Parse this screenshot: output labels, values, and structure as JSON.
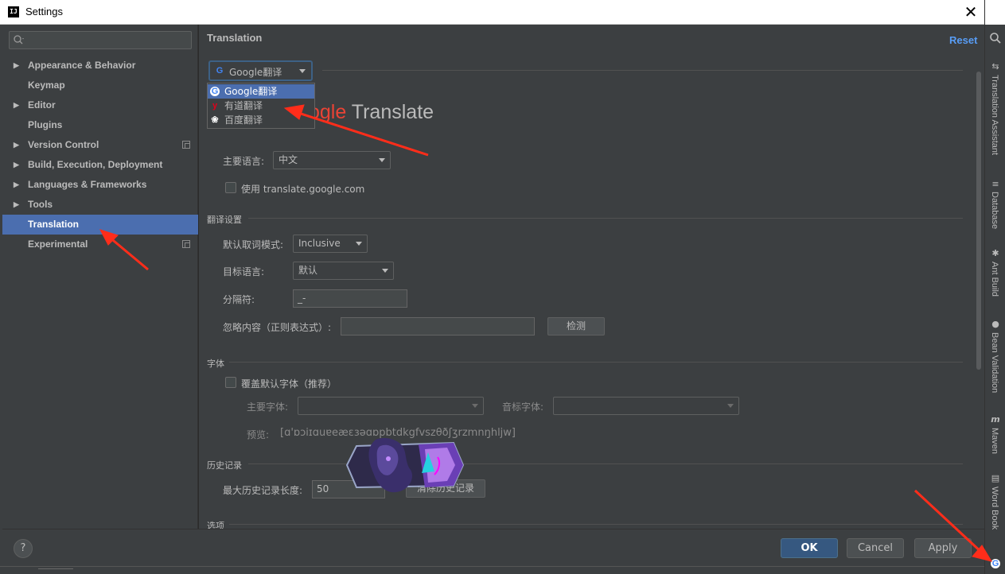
{
  "window": {
    "title": "Settings"
  },
  "nav": {
    "items": [
      {
        "label": "Appearance & Behavior",
        "arrow": "▶",
        "copy": false
      },
      {
        "label": "Keymap",
        "arrow": "",
        "copy": false
      },
      {
        "label": "Editor",
        "arrow": "▶",
        "copy": false
      },
      {
        "label": "Plugins",
        "arrow": "",
        "copy": false
      },
      {
        "label": "Version Control",
        "arrow": "▶",
        "copy": true
      },
      {
        "label": "Build, Execution, Deployment",
        "arrow": "▶",
        "copy": false
      },
      {
        "label": "Languages & Frameworks",
        "arrow": "▶",
        "copy": false
      },
      {
        "label": "Tools",
        "arrow": "▶",
        "copy": false
      },
      {
        "label": "Translation",
        "arrow": "",
        "copy": false,
        "selected": true
      },
      {
        "label": "Experimental",
        "arrow": "",
        "copy": true
      }
    ]
  },
  "content": {
    "title": "Translation",
    "reset": "Reset",
    "engine": {
      "selected": "Google翻译",
      "options": [
        {
          "label": "Google翻译",
          "icon": "google-icon"
        },
        {
          "label": "有道翻译",
          "icon": "youdao-icon"
        },
        {
          "label": "百度翻译",
          "icon": "baidu-icon"
        }
      ],
      "logo_tail": "ogle",
      "logo_word": "Translate"
    },
    "primary_lang": {
      "label": "主要语言:",
      "value": "中文"
    },
    "use_google_cn": {
      "label": "使用 translate.google.com",
      "checked": false
    },
    "translation_settings": {
      "section": "翻译设置",
      "word_mode": {
        "label": "默认取词模式:",
        "value": "Inclusive"
      },
      "target_lang": {
        "label": "目标语言:",
        "value": "默认"
      },
      "separator": {
        "label": "分隔符:",
        "value": "_-"
      },
      "ignore": {
        "label": "忽略内容（正则表达式）:",
        "value": "",
        "button": "检测"
      }
    },
    "font": {
      "section": "字体",
      "override": {
        "label": "覆盖默认字体（推荐）",
        "checked": false
      },
      "primary_font": {
        "label": "主要字体:",
        "value": ""
      },
      "phonetic_font": {
        "label": "音标字体:",
        "value": ""
      },
      "preview_label": "预览:",
      "preview_text": "[ɑ'ɒɔiɪɑuɐeæɛɜəɑɒpbtdkgfvszθðʃʒrzmnŋhljw]"
    },
    "history": {
      "section": "历史记录",
      "max_len": {
        "label": "最大历史记录长度:",
        "value": "50"
      },
      "clear_button": "清除历史记录"
    },
    "options": {
      "section": "选项"
    }
  },
  "buttons": {
    "help": "?",
    "ok": "OK",
    "cancel": "Cancel",
    "apply": "Apply"
  },
  "right_tools": [
    {
      "label": "Translation Assistant",
      "icon": "translate-icon"
    },
    {
      "label": "Database",
      "icon": "database-icon"
    },
    {
      "label": "Ant Build",
      "icon": "ant-icon"
    },
    {
      "label": "Bean Validation",
      "icon": "bean-icon"
    },
    {
      "label": "Maven",
      "icon": "maven-icon"
    },
    {
      "label": "Word Book",
      "icon": "book-icon"
    }
  ],
  "colors": {
    "accent": "#4b6eaf",
    "link": "#589df6",
    "annotation_arrow": "#ff2d1a",
    "ok": "#365880"
  }
}
